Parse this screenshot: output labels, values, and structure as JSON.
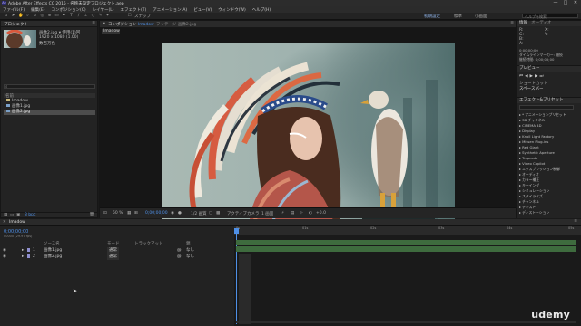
{
  "titlebar": {
    "title": "Adobe After Effects CC 2015 - 名称未設定プロジェクト.aep",
    "minimize": "—",
    "maximize": "□",
    "close": "✕"
  },
  "menu": [
    "ファイル(F)",
    "編集(E)",
    "コンポジション(C)",
    "レイヤー(L)",
    "エフェクト(T)",
    "アニメーション(A)",
    "ビュー(V)",
    "ウィンドウ(W)",
    "ヘルプ(H)"
  ],
  "toolbar": {
    "snap_label": "スナップ",
    "workspace_default": "初期設定",
    "workspace_standard": "標準",
    "workspace_small": "小画面",
    "search_placeholder": "ヘルプを検索"
  },
  "project": {
    "tab": "プロジェクト",
    "selected_name": "画像2.jpg",
    "usage": "使用(1)回",
    "dimensions": "1920 x 1080 (1.00)",
    "color": "数百万色",
    "search_placeholder": "",
    "col_name": "名前",
    "items": [
      {
        "name": "Imadow",
        "color": "#c8b87a",
        "selected": false
      },
      {
        "name": "画像1.jpg",
        "color": "#7aa0c8",
        "selected": false
      },
      {
        "name": "画像2.jpg",
        "color": "#7aa0c8",
        "selected": true
      }
    ],
    "bpc": "8 bpc"
  },
  "composition": {
    "tab": "コンポジション",
    "comp_name": "Imadow",
    "footage_tab": "フッテージ 画像2.jpg",
    "subtab": "Imadow",
    "zoom": "50 %",
    "timecode": "0;00;00;00",
    "quality": "1/2 画質",
    "camera": "アクティブカメラ",
    "views": "1 画面",
    "offset": "+0.0"
  },
  "right_panel": {
    "info_tab": "情報",
    "audio_tab": "オーディオ",
    "x_label": "X:",
    "y_label": "Y:",
    "r": "R:",
    "g": "G:",
    "b": "B:",
    "a": "A:",
    "timecode": "0;00;00;00",
    "info_line": "タイムラインマーカー: 継続",
    "duration": "継続時間: 0;00;05;00",
    "preview_tab": "プレビュー",
    "shortcut": "ショートカット",
    "spacebar": "スペースバー",
    "effects_tab": "エフェクト&プリセット",
    "effects": [
      "* アニメーションプリセット",
      "3D チャンネル",
      "CINEMA 4D",
      "Display",
      "Knoll Light Factory",
      "Missen Plug-ins",
      "Red Giant",
      "Synthetic Aperture",
      "Trapcode",
      "Video Copilot",
      "エクスプレッション制御",
      "オーディオ",
      "カラー補正",
      "キーイング",
      "シミュレーション",
      "スタイライズ",
      "チャンネル",
      "テキスト",
      "ディストーション"
    ]
  },
  "timeline": {
    "tab": "Imadow",
    "timecode": "0;00;00;00",
    "fps": "00000 (29.97 fps)",
    "col_source": "ソース名",
    "col_mode": "モード",
    "col_trkmat": "トラックマット",
    "col_parent": "親",
    "layers": [
      {
        "index": "1",
        "name": "画像1.jpg",
        "mode": "通常",
        "parent": "なし"
      },
      {
        "index": "2",
        "name": "画像2.jpg",
        "mode": "通常",
        "parent": "なし"
      }
    ],
    "ticks": [
      "0s",
      "01s",
      "02s",
      "03s",
      "04s",
      "05s"
    ]
  },
  "watermark": "udemy",
  "colors": {
    "accent_blue": "#4e8fe6",
    "timeline_bar": "#3e6b3e",
    "layer_label": "#8f8fd0"
  }
}
